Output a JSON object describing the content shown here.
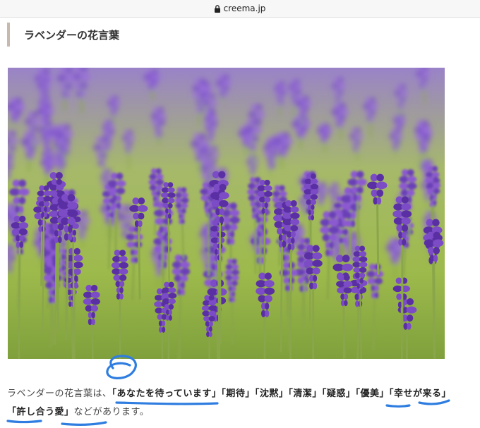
{
  "browser": {
    "url": "creema.jp"
  },
  "article": {
    "heading": "ラベンダーの花言葉",
    "photo_alt": "ラベンダー",
    "paragraph": {
      "intro": "ラベンダーの花言葉は、",
      "meanings": [
        "「あなたを待っています」",
        "「期待」",
        "「沈黙」",
        "「清潔」",
        "「疑惑」",
        "「優美」",
        "「幸せが来る」",
        "「許し合う愛」"
      ],
      "outro": "などがあります。"
    }
  },
  "colors": {
    "accent_bar": "#c7b9ad",
    "annotation_ink": "#2f7de0",
    "lavender": "#7b4fc9",
    "field_green": "#9fbd4a"
  }
}
